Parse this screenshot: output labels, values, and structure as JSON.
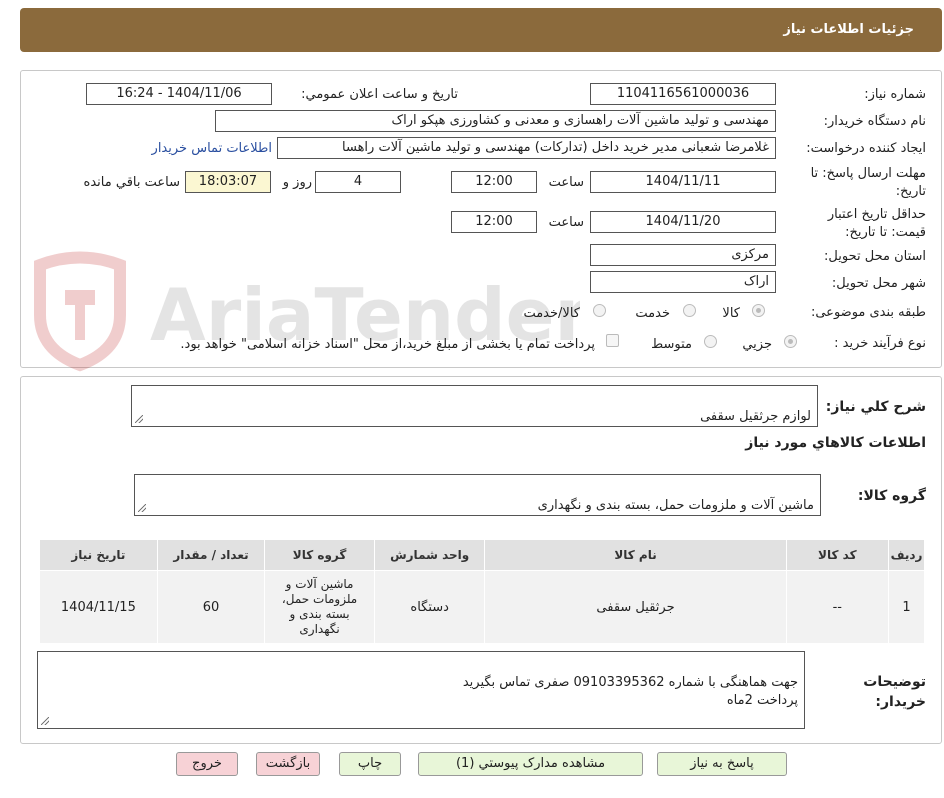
{
  "header": {
    "title": "جزئیات اطلاعات نیاز"
  },
  "form": {
    "need_number_label": "شماره نیاز:",
    "need_number": "1104116561000036",
    "announce_label": "تاریخ و ساعت اعلان عمومي:",
    "announce_value": "1404/11/06 - 16:24",
    "buyer_org_label": "نام دستگاه خریدار:",
    "buyer_org": "مهندسی و تولید ماشین آلات راهسازی و معدنی و کشاورزی هپکو اراک",
    "requester_label": "ایجاد کننده درخواست:",
    "requester": "غلامرضا شعبانی مدیر خرید داخل (تدارکات) مهندسی و تولید ماشین آلات راهسا",
    "contact_link": "اطلاعات تماس خریدار",
    "deadline_label": "مهلت ارسال پاسخ: تا تاریخ:",
    "deadline_date": "1404/11/11",
    "time_label": "ساعت",
    "deadline_time": "12:00",
    "days_value": "4",
    "days_label": "روز و",
    "remaining_time": "18:03:07",
    "remaining_label": "ساعت باقي مانده",
    "validity_label": "حداقل تاریخ اعتبار قیمت: تا تاریخ:",
    "validity_date": "1404/11/20",
    "validity_time": "12:00",
    "province_label": "استان محل تحویل:",
    "province": "مرکزی",
    "city_label": "شهر محل تحویل:",
    "city": "اراک",
    "category_label": "طبقه بندی موضوعی:",
    "category_options": [
      "کالا",
      "خدمت",
      "کالا/خدمت"
    ],
    "process_label": "نوع فرآیند خرید :",
    "process_options": [
      "جزيي",
      "متوسط"
    ],
    "payment_note": "پرداخت تمام یا بخشی از مبلغ خرید،از محل \"اسناد خزانه اسلامی\" خواهد بود."
  },
  "details": {
    "summary_label": "شرح کلي نياز:",
    "summary": "لوازم جرثقیل سقفی",
    "goods_info_title": "اطلاعات کالاهاي مورد نياز",
    "goods_group_label": "گروه کالا:",
    "goods_group": "ماشین آلات و ملزومات حمل، بسته بندی و نگهداری",
    "table": {
      "headers": [
        "رديف",
        "کد کالا",
        "نام کالا",
        "واحد شمارش",
        "گروه کالا",
        "تعداد / مقدار",
        "تاریخ نیاز"
      ],
      "rows": [
        [
          "1",
          "--",
          "جرثقیل سقفی",
          "دستگاه",
          "ماشین آلات و ملزومات حمل، بسته بندی و نگهداری",
          "60",
          "1404/11/15"
        ]
      ]
    },
    "buyer_notes_label": "توضیحات خریدار:",
    "buyer_notes": "جهت هماهنگی با شماره 09103395362 صفری تماس بگیرید\nپرداخت 2ماه"
  },
  "buttons": {
    "reply": "پاسخ به نياز",
    "attachments": "مشاهده مدارک پيوستي (1)",
    "print": "چاپ",
    "back": "بازگشت",
    "exit": "خروج"
  },
  "watermark": {
    "text": "AriaTender.neT"
  }
}
